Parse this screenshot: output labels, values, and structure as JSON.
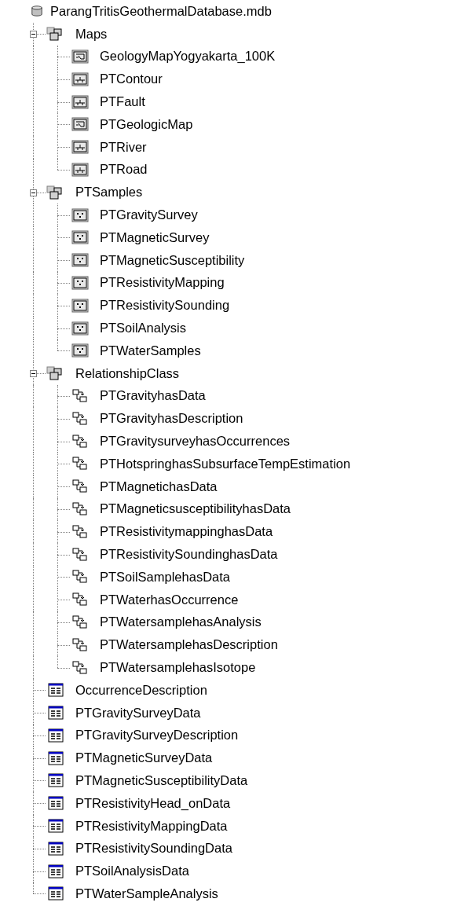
{
  "tree": {
    "label": "ParangTritisGeothermalDatabase.mdb",
    "kind": "database",
    "children": [
      {
        "label": "Maps",
        "kind": "dataset",
        "expanded": true,
        "children": [
          {
            "label": "GeologyMapYogyakarta_100K",
            "kind": "raster"
          },
          {
            "label": "PTContour",
            "kind": "line"
          },
          {
            "label": "PTFault",
            "kind": "line"
          },
          {
            "label": "PTGeologicMap",
            "kind": "raster"
          },
          {
            "label": "PTRiver",
            "kind": "line"
          },
          {
            "label": "PTRoad",
            "kind": "line"
          }
        ]
      },
      {
        "label": "PTSamples",
        "kind": "dataset",
        "expanded": true,
        "children": [
          {
            "label": "PTGravitySurvey",
            "kind": "point"
          },
          {
            "label": "PTMagneticSurvey",
            "kind": "point"
          },
          {
            "label": "PTMagneticSusceptibility",
            "kind": "point"
          },
          {
            "label": "PTResistivityMapping",
            "kind": "point"
          },
          {
            "label": "PTResistivitySounding",
            "kind": "point"
          },
          {
            "label": "PTSoilAnalysis",
            "kind": "point"
          },
          {
            "label": "PTWaterSamples",
            "kind": "point"
          }
        ]
      },
      {
        "label": "RelationshipClass",
        "kind": "dataset",
        "expanded": true,
        "children": [
          {
            "label": "PTGravityhasData",
            "kind": "relationship"
          },
          {
            "label": "PTGravityhasDescription",
            "kind": "relationship"
          },
          {
            "label": "PTGravitysurveyhasOccurrences",
            "kind": "relationship"
          },
          {
            "label": "PTHotspringhasSubsurfaceTempEstimation",
            "kind": "relationship"
          },
          {
            "label": "PTMagnetichasData",
            "kind": "relationship"
          },
          {
            "label": "PTMagneticsusceptibilityhasData",
            "kind": "relationship"
          },
          {
            "label": "PTResistivitymappinghasData",
            "kind": "relationship"
          },
          {
            "label": "PTResistivitySoundinghasData",
            "kind": "relationship"
          },
          {
            "label": "PTSoilSamplehasData",
            "kind": "relationship"
          },
          {
            "label": "PTWaterhasOccurrence",
            "kind": "relationship"
          },
          {
            "label": "PTWatersamplehasAnalysis",
            "kind": "relationship"
          },
          {
            "label": "PTWatersamplehasDescription",
            "kind": "relationship"
          },
          {
            "label": "PTWatersamplehasIsotope",
            "kind": "relationship"
          }
        ]
      },
      {
        "label": "OccurrenceDescription",
        "kind": "table"
      },
      {
        "label": "PTGravitySurveyData",
        "kind": "table"
      },
      {
        "label": "PTGravitySurveyDescription",
        "kind": "table"
      },
      {
        "label": "PTMagneticSurveyData",
        "kind": "table"
      },
      {
        "label": "PTMagneticSusceptibilityData",
        "kind": "table"
      },
      {
        "label": "PTResistivityHead_onData",
        "kind": "table"
      },
      {
        "label": "PTResistivityMappingData",
        "kind": "table"
      },
      {
        "label": "PTResistivitySoundingData",
        "kind": "table"
      },
      {
        "label": "PTSoilAnalysisData",
        "kind": "table"
      },
      {
        "label": "PTWaterSampleAnalysis",
        "kind": "table"
      }
    ]
  }
}
